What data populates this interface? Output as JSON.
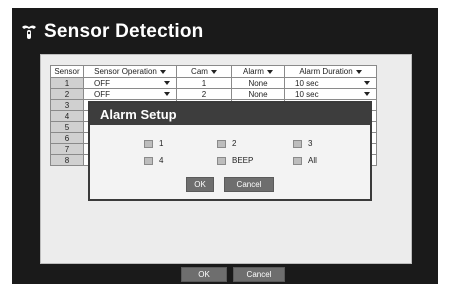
{
  "title": "Sensor Detection",
  "table": {
    "headers": [
      "Sensor",
      "Sensor Operation",
      "Cam",
      "Alarm",
      "Alarm Duration"
    ],
    "rows": [
      {
        "sensor": "1",
        "operation": "OFF",
        "cam": "1",
        "alarm": "None",
        "duration": "10 sec"
      },
      {
        "sensor": "2",
        "operation": "OFF",
        "cam": "2",
        "alarm": "None",
        "duration": "10 sec"
      },
      {
        "sensor": "3",
        "operation": "",
        "cam": "",
        "alarm": "",
        "duration": ""
      },
      {
        "sensor": "4",
        "operation": "",
        "cam": "",
        "alarm": "",
        "duration": ""
      },
      {
        "sensor": "5",
        "operation": "",
        "cam": "",
        "alarm": "",
        "duration": ""
      },
      {
        "sensor": "6",
        "operation": "",
        "cam": "",
        "alarm": "",
        "duration": ""
      },
      {
        "sensor": "7",
        "operation": "",
        "cam": "",
        "alarm": "",
        "duration": ""
      },
      {
        "sensor": "8",
        "operation": "",
        "cam": "",
        "alarm": "",
        "duration": ""
      }
    ]
  },
  "footer": {
    "ok_label": "OK",
    "cancel_label": "Cancel"
  },
  "dialog": {
    "title": "Alarm Setup",
    "options": [
      "1",
      "2",
      "3",
      "4",
      "BEEP",
      "All"
    ],
    "ok_label": "OK",
    "cancel_label": "Cancel"
  },
  "icons": {
    "title_icon": "sensor-icon"
  },
  "colors": {
    "frame": "#1a1a1a",
    "panel": "#ececec",
    "dialog_header": "#3d3d3d",
    "button": "#6e6e6e"
  }
}
